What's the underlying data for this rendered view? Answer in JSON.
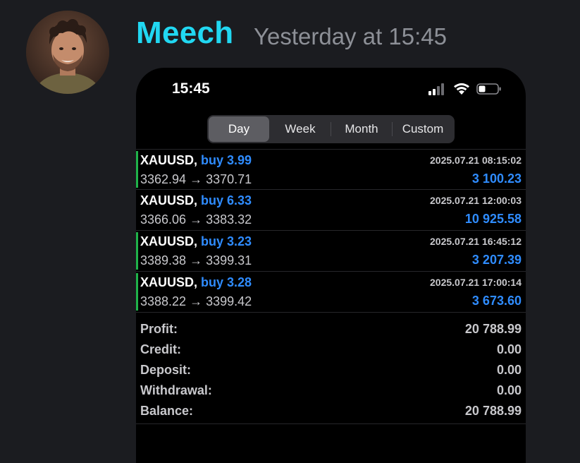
{
  "message": {
    "username": "Meech",
    "timestamp": "Yesterday at 15:45"
  },
  "colors": {
    "username": "#21d8f2",
    "accent_blue": "#2f8cff",
    "buy_bar": "#1fb34a"
  },
  "status_bar": {
    "time": "15:45",
    "icons": [
      "signal-icon",
      "wifi-icon",
      "battery-icon"
    ]
  },
  "tabs": [
    {
      "label": "Day",
      "active": true
    },
    {
      "label": "Week",
      "active": false
    },
    {
      "label": "Month",
      "active": false
    },
    {
      "label": "Custom",
      "active": false
    }
  ],
  "deals": [
    {
      "symbol": "XAUUSD,",
      "side": "buy 3.99",
      "prices": "3362.94 → 3370.71",
      "datetime": "2025.07.21 08:15:02",
      "profit": "3 100.23",
      "marked": true
    },
    {
      "symbol": "XAUUSD,",
      "side": "buy 6.33",
      "prices": "3366.06 → 3383.32",
      "datetime": "2025.07.21 12:00:03",
      "profit": "10 925.58",
      "marked": false
    },
    {
      "symbol": "XAUUSD,",
      "side": "buy 3.23",
      "prices": "3389.38 → 3399.31",
      "datetime": "2025.07.21 16:45:12",
      "profit": "3 207.39",
      "marked": true
    },
    {
      "symbol": "XAUUSD,",
      "side": "buy 3.28",
      "prices": "3388.22 → 3399.42",
      "datetime": "2025.07.21 17:00:14",
      "profit": "3 673.60",
      "marked": true
    }
  ],
  "summary": [
    {
      "label": "Profit:",
      "value": "20 788.99"
    },
    {
      "label": "Credit:",
      "value": "0.00"
    },
    {
      "label": "Deposit:",
      "value": "0.00"
    },
    {
      "label": "Withdrawal:",
      "value": "0.00"
    },
    {
      "label": "Balance:",
      "value": "20 788.99"
    }
  ]
}
